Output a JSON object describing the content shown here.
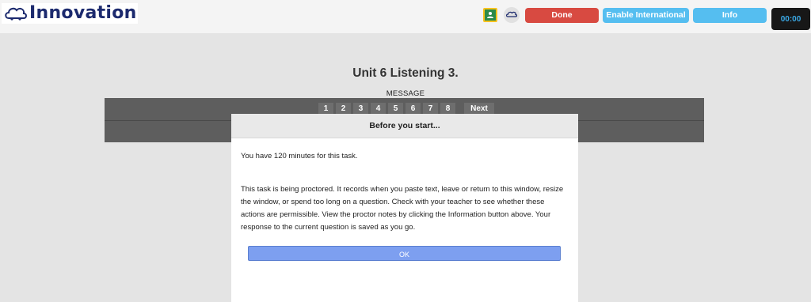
{
  "app": {
    "logo_text": "Innovation"
  },
  "toolbar": {
    "icons": [
      "google-classroom-icon",
      "cloud-icon"
    ],
    "done_label": "Done",
    "enable_international_label": "Enable International",
    "info_label": "Info",
    "timer": "00:00",
    "colors": {
      "done": "#d84a41",
      "intl": "#55bef0",
      "info": "#55bef0",
      "timer_bg": "#171717",
      "timer_text": "#3aa9e6"
    }
  },
  "main": {
    "title": "Unit 6 Listening 3.",
    "message_label": "MESSAGE",
    "questions": [
      "1",
      "2",
      "3",
      "4",
      "5",
      "6",
      "7",
      "8"
    ],
    "next_label": "Next"
  },
  "dialog": {
    "title": "Before you start...",
    "time_text": "You have 120 minutes for this task.",
    "proctor_text": "This task is being proctored. It records when you paste text, leave or return to this window, resize the window, or spend too long on a question. Check with your teacher to see whether these actions are permissible. View the proctor notes by clicking the Information button above. Your response to the current question is saved as you go.",
    "ok_label": "OK",
    "ok_color": "#7d9ff0"
  }
}
